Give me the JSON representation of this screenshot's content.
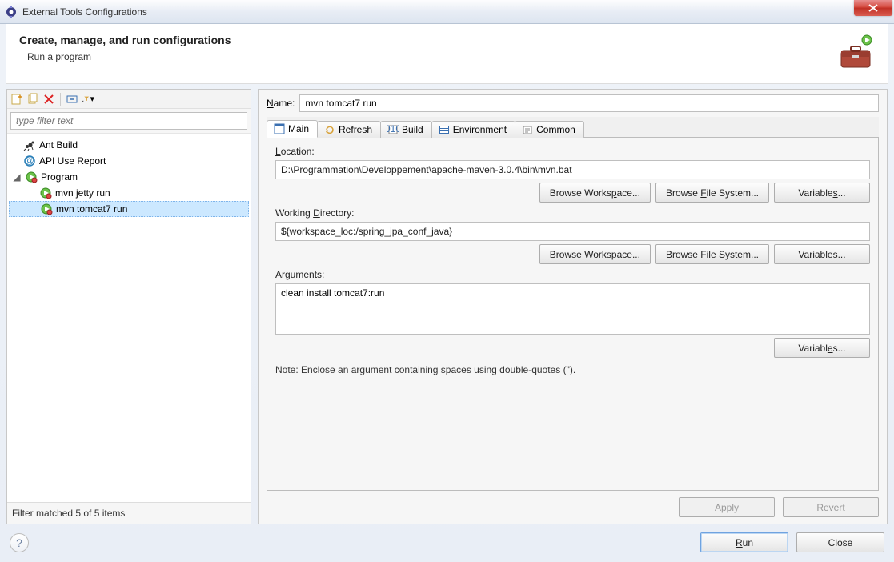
{
  "window": {
    "title": "External Tools Configurations"
  },
  "header": {
    "title": "Create, manage, and run configurations",
    "subtitle": "Run a program"
  },
  "left": {
    "filter_placeholder": "type filter text",
    "status": "Filter matched 5 of 5 items",
    "tree": {
      "ant": "Ant Build",
      "api": "API Use Report",
      "program": "Program",
      "child1": "mvn jetty run",
      "child2": "mvn tomcat7 run"
    }
  },
  "right": {
    "name_label_pre": "N",
    "name_label_post": "ame:",
    "name_value": "mvn tomcat7 run",
    "tabs": {
      "main": "Main",
      "refresh": "Refresh",
      "build": "Build",
      "environment": "Environment",
      "common": "Common"
    },
    "location": {
      "label_pre": "L",
      "label_post": "ocation:",
      "value": "D:\\Programmation\\Developpement\\apache-maven-3.0.4\\bin\\mvn.bat"
    },
    "workdir": {
      "label": "Working Directory:",
      "value": "${workspace_loc:/spring_jpa_conf_java}"
    },
    "args": {
      "label_pre": "A",
      "label_post": "rguments:",
      "value": "clean install tomcat7:run"
    },
    "buttons": {
      "browse_ws": "Browse Workspace...",
      "browse_fs": "Browse File System...",
      "variables": "Variables...",
      "apply": "Apply",
      "revert": "Revert",
      "run": "Run",
      "close": "Close"
    },
    "note": "Note: Enclose an argument containing spaces using double-quotes (\")."
  }
}
